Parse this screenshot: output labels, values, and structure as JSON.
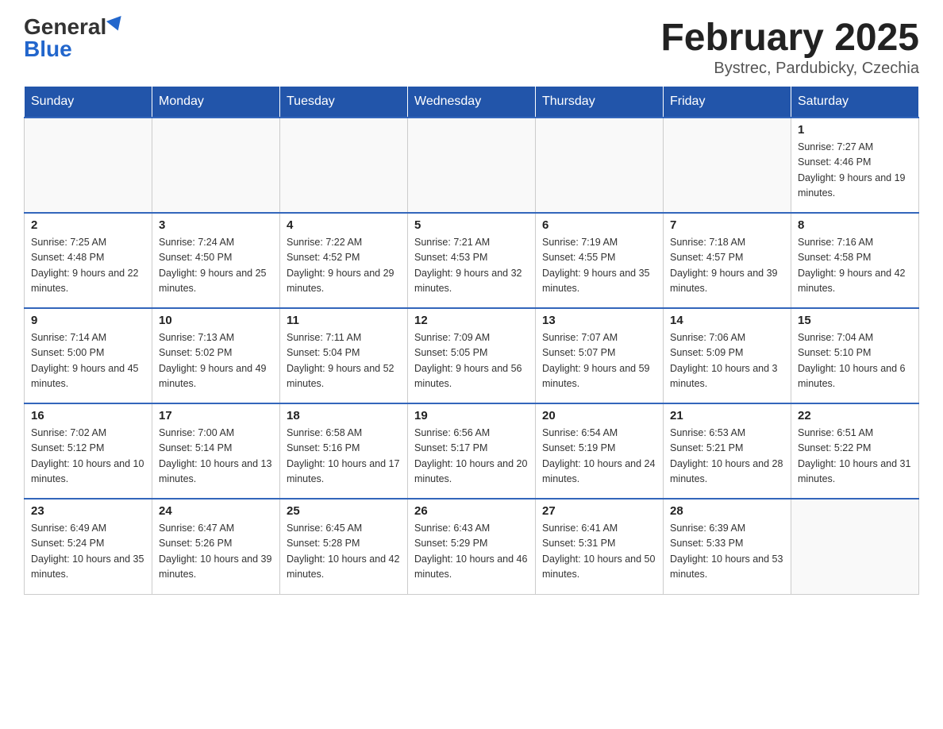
{
  "logo": {
    "general": "General",
    "blue": "Blue"
  },
  "title": "February 2025",
  "subtitle": "Bystrec, Pardubicky, Czechia",
  "weekdays": [
    "Sunday",
    "Monday",
    "Tuesday",
    "Wednesday",
    "Thursday",
    "Friday",
    "Saturday"
  ],
  "weeks": [
    [
      {
        "day": "",
        "info": ""
      },
      {
        "day": "",
        "info": ""
      },
      {
        "day": "",
        "info": ""
      },
      {
        "day": "",
        "info": ""
      },
      {
        "day": "",
        "info": ""
      },
      {
        "day": "",
        "info": ""
      },
      {
        "day": "1",
        "info": "Sunrise: 7:27 AM\nSunset: 4:46 PM\nDaylight: 9 hours and 19 minutes."
      }
    ],
    [
      {
        "day": "2",
        "info": "Sunrise: 7:25 AM\nSunset: 4:48 PM\nDaylight: 9 hours and 22 minutes."
      },
      {
        "day": "3",
        "info": "Sunrise: 7:24 AM\nSunset: 4:50 PM\nDaylight: 9 hours and 25 minutes."
      },
      {
        "day": "4",
        "info": "Sunrise: 7:22 AM\nSunset: 4:52 PM\nDaylight: 9 hours and 29 minutes."
      },
      {
        "day": "5",
        "info": "Sunrise: 7:21 AM\nSunset: 4:53 PM\nDaylight: 9 hours and 32 minutes."
      },
      {
        "day": "6",
        "info": "Sunrise: 7:19 AM\nSunset: 4:55 PM\nDaylight: 9 hours and 35 minutes."
      },
      {
        "day": "7",
        "info": "Sunrise: 7:18 AM\nSunset: 4:57 PM\nDaylight: 9 hours and 39 minutes."
      },
      {
        "day": "8",
        "info": "Sunrise: 7:16 AM\nSunset: 4:58 PM\nDaylight: 9 hours and 42 minutes."
      }
    ],
    [
      {
        "day": "9",
        "info": "Sunrise: 7:14 AM\nSunset: 5:00 PM\nDaylight: 9 hours and 45 minutes."
      },
      {
        "day": "10",
        "info": "Sunrise: 7:13 AM\nSunset: 5:02 PM\nDaylight: 9 hours and 49 minutes."
      },
      {
        "day": "11",
        "info": "Sunrise: 7:11 AM\nSunset: 5:04 PM\nDaylight: 9 hours and 52 minutes."
      },
      {
        "day": "12",
        "info": "Sunrise: 7:09 AM\nSunset: 5:05 PM\nDaylight: 9 hours and 56 minutes."
      },
      {
        "day": "13",
        "info": "Sunrise: 7:07 AM\nSunset: 5:07 PM\nDaylight: 9 hours and 59 minutes."
      },
      {
        "day": "14",
        "info": "Sunrise: 7:06 AM\nSunset: 5:09 PM\nDaylight: 10 hours and 3 minutes."
      },
      {
        "day": "15",
        "info": "Sunrise: 7:04 AM\nSunset: 5:10 PM\nDaylight: 10 hours and 6 minutes."
      }
    ],
    [
      {
        "day": "16",
        "info": "Sunrise: 7:02 AM\nSunset: 5:12 PM\nDaylight: 10 hours and 10 minutes."
      },
      {
        "day": "17",
        "info": "Sunrise: 7:00 AM\nSunset: 5:14 PM\nDaylight: 10 hours and 13 minutes."
      },
      {
        "day": "18",
        "info": "Sunrise: 6:58 AM\nSunset: 5:16 PM\nDaylight: 10 hours and 17 minutes."
      },
      {
        "day": "19",
        "info": "Sunrise: 6:56 AM\nSunset: 5:17 PM\nDaylight: 10 hours and 20 minutes."
      },
      {
        "day": "20",
        "info": "Sunrise: 6:54 AM\nSunset: 5:19 PM\nDaylight: 10 hours and 24 minutes."
      },
      {
        "day": "21",
        "info": "Sunrise: 6:53 AM\nSunset: 5:21 PM\nDaylight: 10 hours and 28 minutes."
      },
      {
        "day": "22",
        "info": "Sunrise: 6:51 AM\nSunset: 5:22 PM\nDaylight: 10 hours and 31 minutes."
      }
    ],
    [
      {
        "day": "23",
        "info": "Sunrise: 6:49 AM\nSunset: 5:24 PM\nDaylight: 10 hours and 35 minutes."
      },
      {
        "day": "24",
        "info": "Sunrise: 6:47 AM\nSunset: 5:26 PM\nDaylight: 10 hours and 39 minutes."
      },
      {
        "day": "25",
        "info": "Sunrise: 6:45 AM\nSunset: 5:28 PM\nDaylight: 10 hours and 42 minutes."
      },
      {
        "day": "26",
        "info": "Sunrise: 6:43 AM\nSunset: 5:29 PM\nDaylight: 10 hours and 46 minutes."
      },
      {
        "day": "27",
        "info": "Sunrise: 6:41 AM\nSunset: 5:31 PM\nDaylight: 10 hours and 50 minutes."
      },
      {
        "day": "28",
        "info": "Sunrise: 6:39 AM\nSunset: 5:33 PM\nDaylight: 10 hours and 53 minutes."
      },
      {
        "day": "",
        "info": ""
      }
    ]
  ]
}
